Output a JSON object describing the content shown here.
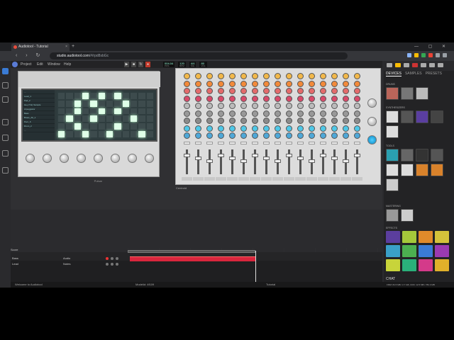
{
  "browser": {
    "tab_title": "Audiotool - Tutorial",
    "new_tab": "+",
    "url_host": "studio.audiotool.com",
    "url_path": "/#/rpd8sbGc",
    "window_controls": "— ▢ ✕"
  },
  "menu": {
    "items": [
      "Project",
      "Edit",
      "Window",
      "Help"
    ],
    "counters": [
      {
        "value": "004.04",
        "label": "POS"
      },
      {
        "value": "120",
        "label": "BPM"
      },
      {
        "value": "4/4",
        "label": "SIG"
      },
      {
        "value": "80",
        "label": "VOL"
      }
    ]
  },
  "synth": {
    "label": "Pulsar",
    "patches": [
      "...",
      "Lead_1",
      "Pad_2",
      "Hey (Tut) Sample",
      "Arpeggiator",
      "Bass",
      "Brass_Alt_1",
      "Perc_6",
      "Drum_2",
      "..."
    ]
  },
  "mixer": {
    "label": "Centroid"
  },
  "right_panel": {
    "tabs": [
      "DEVICES",
      "SAMPLES",
      "PRESETS"
    ],
    "sections": {
      "drums": "DRUMS",
      "synthesizers": "SYNTHESIZERS",
      "tools": "TOOLS",
      "mastering": "MASTERING",
      "effects": "EFFECTS"
    },
    "chat_label": "CHAT"
  },
  "sequencer": {
    "header": "Score",
    "tracks": [
      {
        "name": "Bass",
        "type": "Audio"
      },
      {
        "name": "Lead",
        "type": "Notes"
      }
    ]
  },
  "status": {
    "left": "Welcome to Audiotool",
    "middle_label": "Modelid: 4f109",
    "center": "Tutorial",
    "right": "FMM: 84.5 MB / 2.7 GB, CDN: 12.5 MB / 782.3 MB"
  },
  "colors": {
    "accent_blue": "#3a7bd5",
    "region_red": "#d9263d",
    "led_green": "#dfffe8"
  }
}
